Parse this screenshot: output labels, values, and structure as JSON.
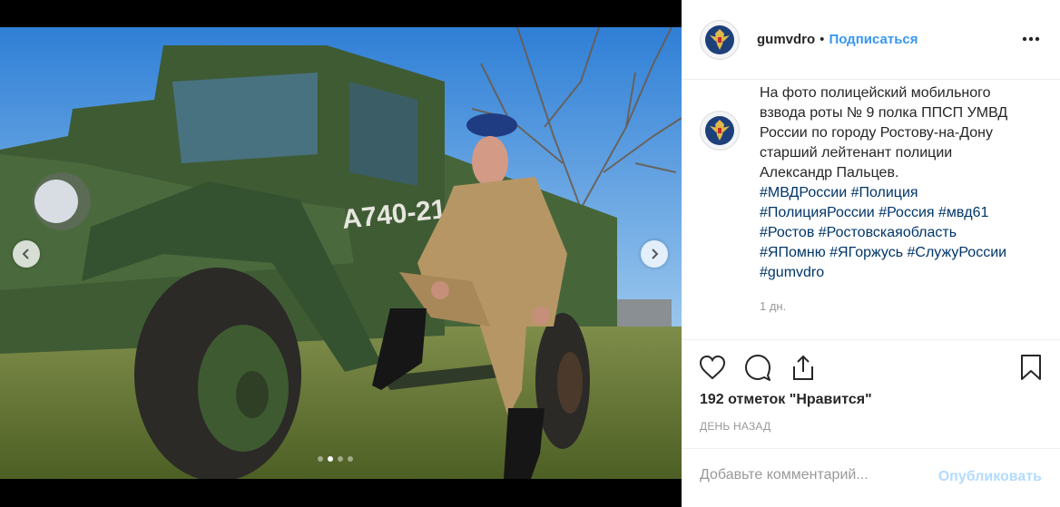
{
  "post": {
    "username": "gumvdro",
    "separator": "•",
    "follow_label": "Подписаться",
    "more_icon": "more-horizontal-icon"
  },
  "caption": {
    "lines": [
      "На фото полицейский мобильного",
      "взвода роты № 9 полка ППСП УМВД",
      "России по городу Ростову-на-Дону",
      "старший лейтенант полиции",
      "Александр Пальцев."
    ],
    "hashtags": [
      "#МВДРоссии",
      "#Полиция",
      "#ПолицияРоссии",
      "#Россия",
      "#мвд61",
      "#Ростов",
      "#Ростовскаяобласть",
      "#ЯПомню",
      "#ЯГоржусь",
      "#СлужуРоссии",
      "#gumvdro"
    ],
    "time_ago": "1 дн."
  },
  "actions": {
    "like_icon": "heart-icon",
    "comment_icon": "comment-icon",
    "share_icon": "share-icon",
    "save_icon": "bookmark-icon"
  },
  "likes_text": "192 отметок \"Нравится\"",
  "date_text": "ДЕНЬ НАЗАД",
  "comment": {
    "placeholder": "Добавьте комментарий...",
    "publish_label": "Опубликовать"
  },
  "carousel": {
    "prev_icon": "chevron-left-icon",
    "next_icon": "chevron-right-icon",
    "slide_count": 4,
    "active_index": 1
  },
  "colors": {
    "link": "#3897f0",
    "hashtag": "#003569",
    "publish_disabled": "#b3dbff",
    "muted": "#999999"
  }
}
